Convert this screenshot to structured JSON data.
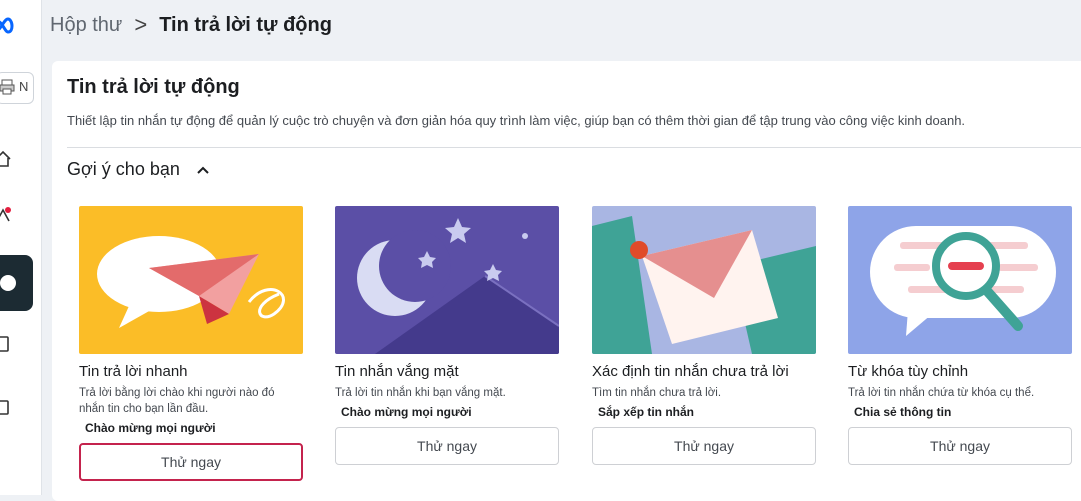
{
  "breadcrumb": {
    "home": "Hộp thư",
    "separator": ">",
    "current": "Tin trả lời tự động"
  },
  "rail": {
    "account_letter": "N"
  },
  "page": {
    "title": "Tin trả lời tự động",
    "description": "Thiết lập tin nhắn tự động để quản lý cuộc trò chuyện và đơn giản hóa quy trình làm việc, giúp bạn có thêm thời gian để tập trung vào công việc kinh doanh."
  },
  "suggestions": {
    "heading": "Gợi ý cho bạn",
    "cards": [
      {
        "name": "Tin trả lời nhanh",
        "description": "Trả lời bằng lời chào khi người nào đó nhắn tin cho bạn lần đầu.",
        "tag": "Chào mừng mọi người",
        "button": "Thử ngay",
        "icon": "paper-plane-illustration"
      },
      {
        "name": "Tin nhắn vắng mặt",
        "description": "Trả lời tin nhắn khi bạn vắng mặt.",
        "tag": "Chào mừng mọi người",
        "button": "Thử ngay",
        "icon": "moon-night-illustration"
      },
      {
        "name": "Xác định tin nhắn chưa trả lời",
        "description": "Tìm tin nhắn chưa trả lời.",
        "tag": "Sắp xếp tin nhắn",
        "button": "Thử ngay",
        "icon": "envelope-illustration"
      },
      {
        "name": "Từ khóa tùy chỉnh",
        "description": "Trả lời tin nhắn chứa từ khóa cụ thể.",
        "tag": "Chia sẻ thông tin",
        "button": "Thử ngay",
        "icon": "magnifier-illustration"
      }
    ]
  },
  "colors": {
    "accent_focus": "#c4234d",
    "yellow": "#fbbd27",
    "purple": "#5b4fa6",
    "periwinkle": "#a9b6e3",
    "blue": "#8ea4e8"
  }
}
